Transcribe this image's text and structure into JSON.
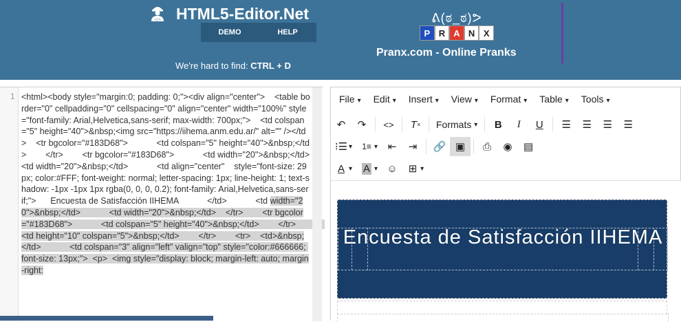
{
  "site": {
    "title": "HTML5-Editor.Net",
    "nav": [
      "DEMO",
      "HELP"
    ],
    "hint_prefix": "We're hard to find:",
    "hint_shortcut": "CTRL + D"
  },
  "ad": {
    "face": "ᕕ(ಠ_ಠ)ᕗ",
    "letters": [
      "P",
      "R",
      "A",
      "N",
      "X"
    ],
    "letter_colors": [
      "#1f4fbf",
      "#ffffff",
      "#e03a2f",
      "#ffffff",
      "#ffffff"
    ],
    "caption": "Pranx.com - Online Pranks"
  },
  "code": {
    "line_number": "1",
    "source_plain": "<html><body style=\"margin:0; padding: 0;\"><div align=\"center\">    <table border=\"0\" cellpadding=\"0\" cellspacing=\"0\" align=\"center\" width=\"100%\" style=\"font-family: Arial,Helvetica,sans-serif; max-width: 700px;\">    <td colspan=\"5\" height=\"40\">&nbsp;<img src=\"https://iihema.anm.edu.ar/\" alt=\"\" /></td>    <tr bgcolor=\"#183D68\">            <td colspan=\"5\" height=\"40\">&nbsp;</td>        </tr>        <tr bgcolor=\"#183D68\">            <td width=\"20\">&nbsp;</td>    <td width=\"20\">&nbsp;</td>            <td align=\"center\"    style=\"font-size: 29px; color:#FFF; font-weight: normal; letter-spacing: 1px; line-height: 1; text-shadow: -1px -1px 1px rgba(0, 0, 0, 0.2); font-family: Arial,Helvetica,sans-serif;\">      Encuesta de Satisfacción IIHEMA            </td>            <td ",
    "source_highlighted": "width=\"20\">&nbsp;</td>            <td width=\"20\">&nbsp;</td>    </tr>        <tr bgcolor=\"#183D68\">            <td colspan=\"5\" height=\"40\">&nbsp;</td>        </tr>            <td height=\"10\" colspan=\"5\">&nbsp;</td>        </tr>        <tr>    <td>&nbsp;</td>            <td colspan=\"3\" align=\"left\" valign=\"top\" style=\"color:#666666; font-size: 13px;\">  <p>  <img style=\"display: block; margin-left: auto; margin-right:"
  },
  "editor": {
    "menus": [
      "File",
      "Edit",
      "Insert",
      "View",
      "Format",
      "Table",
      "Tools"
    ],
    "formats_label": "Formats",
    "document_title": "Encuesta de Satisfacción IIHEMA",
    "document_bg": "#183D68"
  }
}
